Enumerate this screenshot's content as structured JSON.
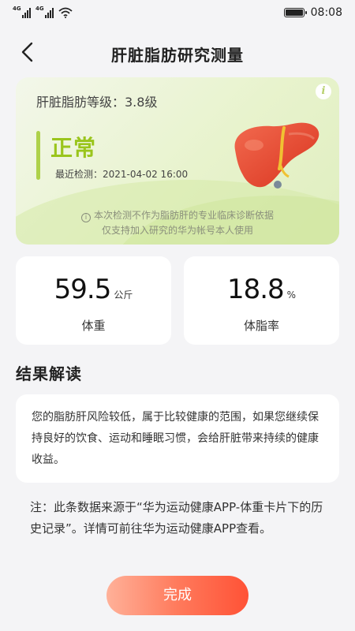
{
  "status_bar": {
    "signal1_tag": "4G",
    "signal2_tag": "4G",
    "time": "08:08",
    "icons": [
      "signal-icon",
      "signal-icon",
      "wifi-icon",
      "battery-icon"
    ]
  },
  "header": {
    "title": "肝脏脂肪研究测量",
    "back_icon": "chevron-left-icon"
  },
  "result": {
    "grade_label": "肝脏脂肪等级：3.8级",
    "level": "正常",
    "last_check": "最近检测：2021-04-02 16:00",
    "disclaimer_line1": "本次检测不作为脂肪肝的专业临床诊断依据",
    "disclaimer_line2": "仅支持加入研究的华为帐号本人使用",
    "info_icon": "i",
    "colors": {
      "level": "#9ac51c",
      "card_bg": "#e8f3cd"
    }
  },
  "metrics": [
    {
      "value": "59.5",
      "unit": "公斤",
      "label": "体重"
    },
    {
      "value": "18.8",
      "unit": "%",
      "label": "体脂率"
    }
  ],
  "interpretation": {
    "title": "结果解读",
    "text": "您的脂肪肝风险较低，属于比较健康的范围，如果您继续保持良好的饮食、运动和睡眠习惯，会给肝脏带来持续的健康收益。"
  },
  "note": "注：此条数据来源于“华为运动健康APP-体重卡片下的历史记录”。详情可前往华为运动健康APP查看。",
  "done_button": {
    "label": "完成",
    "color": "#ff5236"
  }
}
